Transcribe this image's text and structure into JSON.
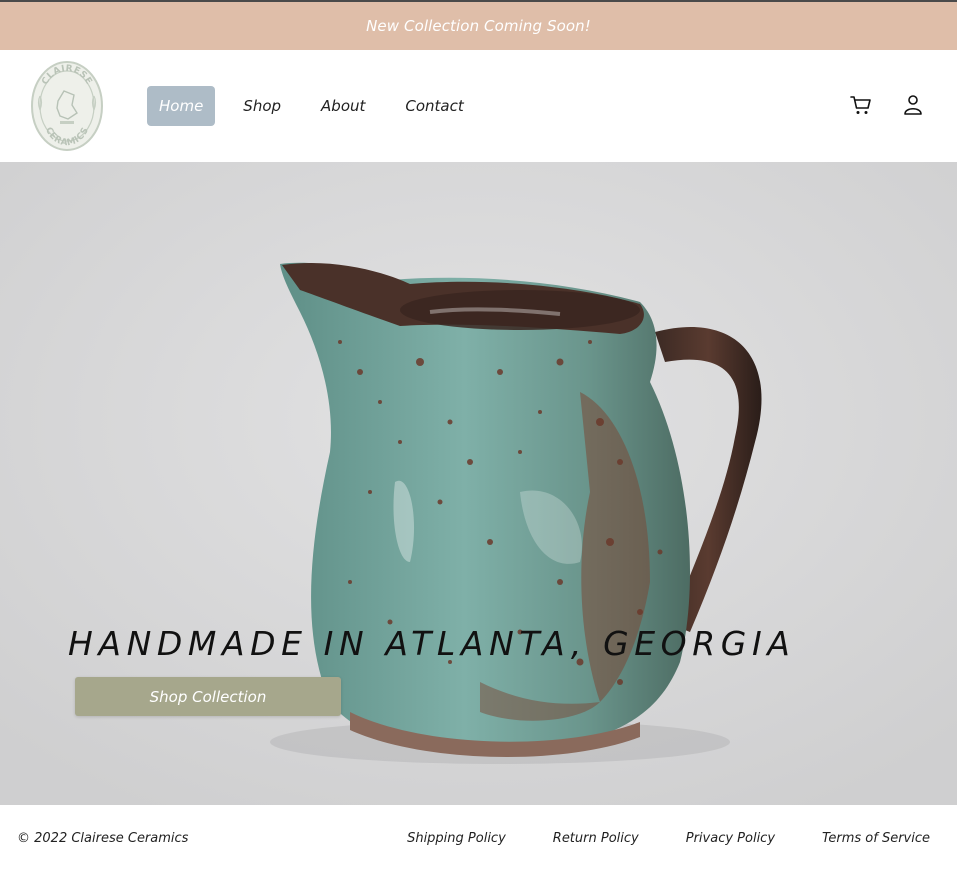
{
  "announcement": {
    "text": "New Collection Coming Soon!"
  },
  "brand": {
    "logo_text_top": "CLAIRESE",
    "logo_text_bottom": "CERAMICS"
  },
  "nav": {
    "items": [
      {
        "label": "Home",
        "active": true
      },
      {
        "label": "Shop",
        "active": false
      },
      {
        "label": "About",
        "active": false
      },
      {
        "label": "Contact",
        "active": false
      }
    ]
  },
  "header_icons": {
    "cart": "cart-icon",
    "account": "user-icon"
  },
  "hero": {
    "title": "HANDMADE IN ATLANTA, GEORGIA",
    "button_label": "Shop Collection"
  },
  "footer": {
    "copyright": "© 2022 Clairese Ceramics",
    "links": [
      "Shipping Policy",
      "Return Policy",
      "Privacy Policy",
      "Terms of Service"
    ]
  },
  "colors": {
    "announcement_bg": "#dfbea9",
    "nav_active_bg": "#aebcc7",
    "button_bg": "#a6a78c",
    "glaze": "#6e9c93"
  }
}
